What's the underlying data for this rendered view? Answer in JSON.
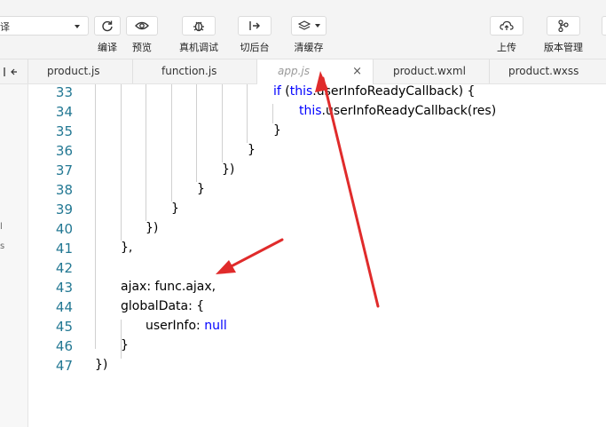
{
  "toolbar": {
    "mode_select_value": "译",
    "buttons": [
      {
        "label": "编译",
        "icon": "refresh-icon"
      },
      {
        "label": "预览",
        "icon": "eye-icon"
      },
      {
        "label": "真机调试",
        "icon": "bug-icon"
      },
      {
        "label": "切后台",
        "icon": "switch-background-icon"
      },
      {
        "label": "清缓存",
        "icon": "layers-icon"
      },
      {
        "label": "上传",
        "icon": "cloud-upload-icon"
      },
      {
        "label": "版本管理",
        "icon": "version-branch-icon"
      }
    ]
  },
  "tabs": [
    {
      "label": "product.js",
      "active": false
    },
    {
      "label": "function.js",
      "active": false
    },
    {
      "label": "app.js",
      "active": true
    },
    {
      "label": "product.wxml",
      "active": false
    },
    {
      "label": "product.wxss",
      "active": false
    }
  ],
  "tab_close_glyph": "×",
  "left_panel": {
    "fragments": [
      "l",
      "s"
    ]
  },
  "editor": {
    "lines": [
      {
        "num": "33",
        "text": "if (this.userInfoReadyCallback) {"
      },
      {
        "num": "34",
        "text": "this.userInfoReadyCallback(res)"
      },
      {
        "num": "35",
        "text": "}"
      },
      {
        "num": "36",
        "text": "}"
      },
      {
        "num": "37",
        "text": "})"
      },
      {
        "num": "38",
        "text": "}"
      },
      {
        "num": "39",
        "text": "}"
      },
      {
        "num": "40",
        "text": "})"
      },
      {
        "num": "41",
        "text": "},"
      },
      {
        "num": "42",
        "text": ""
      },
      {
        "num": "43",
        "text": "ajax: func.ajax,"
      },
      {
        "num": "44",
        "text": "globalData: {"
      },
      {
        "num": "45",
        "text": "userInfo: null"
      },
      {
        "num": "46",
        "text": "}"
      },
      {
        "num": "47",
        "text": "})"
      }
    ]
  },
  "colors": {
    "keyword": "#0000ff",
    "line_number": "#237893",
    "annotation_arrow": "#e02b2b"
  }
}
